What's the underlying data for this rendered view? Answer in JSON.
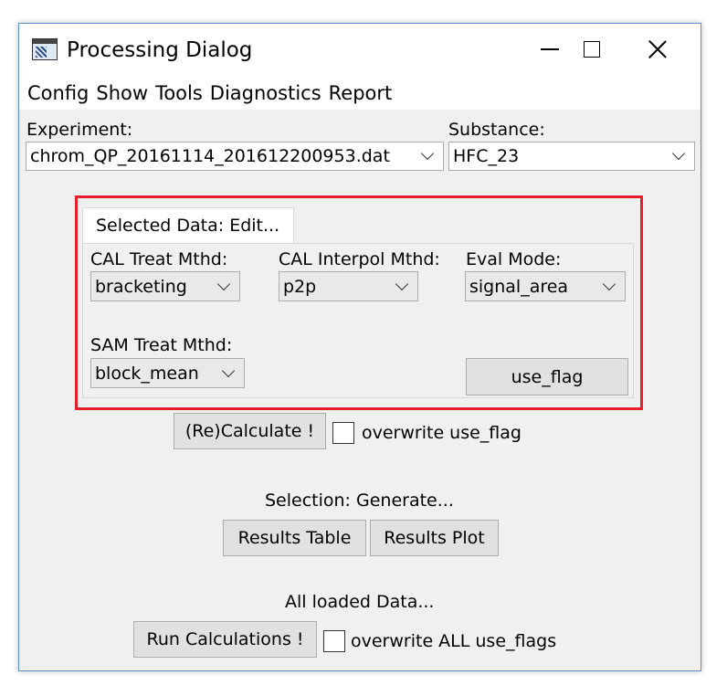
{
  "window": {
    "title": "Processing Dialog",
    "icon": "app-window-icon",
    "controls": [
      "minimize-icon",
      "maximize-icon",
      "close-icon"
    ]
  },
  "menu": {
    "items": [
      "Config",
      "Show",
      "Tools",
      "Diagnostics",
      "Report"
    ]
  },
  "experiment": {
    "label": "Experiment:",
    "value": "chrom_QP_20161114_201612200953.dat"
  },
  "substance": {
    "label": "Substance:",
    "value": "HFC_23"
  },
  "selected_data": {
    "tab_label": "Selected Data: Edit...",
    "cal_treat": {
      "label": "CAL Treat Mthd:",
      "value": "bracketing"
    },
    "cal_interpol": {
      "label": "CAL Interpol Mthd:",
      "value": "p2p"
    },
    "eval_mode": {
      "label": "Eval Mode:",
      "value": "signal_area"
    },
    "sam_treat": {
      "label": "SAM Treat Mthd:",
      "value": "block_mean"
    },
    "use_flag_button": "use_flag",
    "highlight_color": "#e3202a"
  },
  "recalculate": {
    "button": "(Re)Calculate !",
    "overwrite_label": "overwrite use_flag",
    "overwrite_checked": false
  },
  "selection": {
    "label": "Selection: Generate...",
    "results_table": "Results Table",
    "results_plot": "Results Plot"
  },
  "all_loaded": {
    "label": "All loaded Data...",
    "run_button": "Run Calculations !",
    "overwrite_label": "overwrite ALL use_flags",
    "overwrite_checked": false
  }
}
